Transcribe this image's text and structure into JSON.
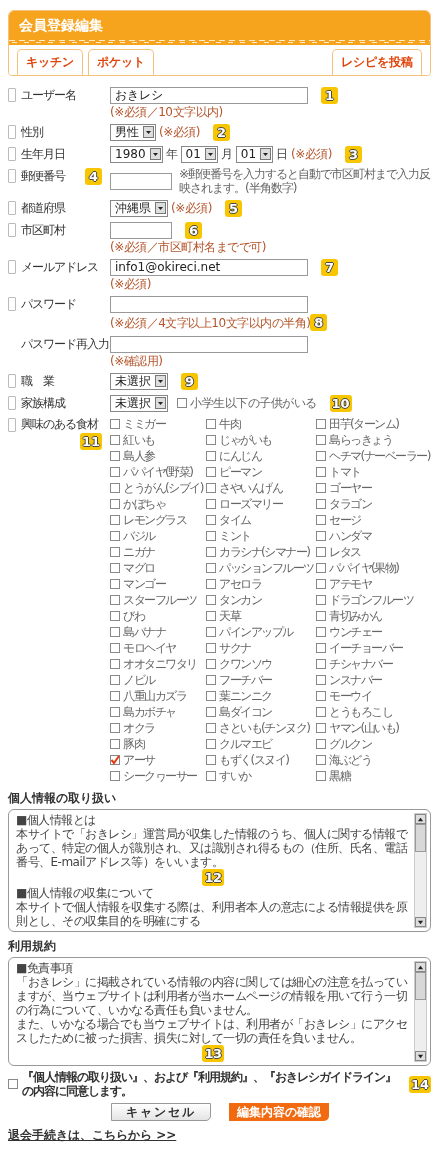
{
  "header": {
    "title": "会員登録編集",
    "tabs": [
      {
        "label": "キッチン",
        "kind": "section"
      },
      {
        "label": "ポケット",
        "kind": "section"
      },
      {
        "label": "レシピを投稿",
        "kind": "action"
      }
    ]
  },
  "form": {
    "rows": [
      {
        "kind": "text",
        "marker": true,
        "label": "ユーザー名",
        "value": "おきレシ",
        "hint": "(※必須／10文字以内)",
        "field_badge": "1"
      },
      {
        "kind": "select",
        "marker": true,
        "label": "性別",
        "value": "男性",
        "note": "(※必須)",
        "field_badge": "2"
      },
      {
        "kind": "date",
        "marker": true,
        "label": "生年月日",
        "parts": [
          {
            "value": "1980",
            "unit": "年"
          },
          {
            "value": "01",
            "unit": "月"
          },
          {
            "value": "01",
            "unit": "日"
          }
        ],
        "note": "(※必須)",
        "field_badge": "3"
      },
      {
        "kind": "short_text",
        "marker": true,
        "label": "郵便番号",
        "info": "※郵便番号を入力すると自動で市区町村まで入力反映されます。(半角数字)",
        "label_badge": "4"
      },
      {
        "kind": "select",
        "marker": true,
        "label": "都道府県",
        "value": "沖縄県",
        "note": "(※必須)",
        "field_badge": "5"
      },
      {
        "kind": "short_text",
        "marker": true,
        "label": "市区町村",
        "hint": "(※必須／市区町村名までで可)",
        "field_badge": "6"
      },
      {
        "kind": "text",
        "marker": true,
        "label": "メールアドレス",
        "value": "info1@okireci.net",
        "hint": "(※必須)",
        "field_badge": "7"
      },
      {
        "kind": "text",
        "marker": true,
        "label": "パスワード",
        "hint": "(※必須／4文字以上10文字以内の半角)",
        "hint_badge": "8"
      },
      {
        "kind": "text",
        "marker": false,
        "label": "パスワード再入力",
        "hint": "(※確認用)"
      },
      {
        "kind": "select",
        "marker": true,
        "label": "職　業",
        "value": "未選択",
        "field_badge": "9"
      },
      {
        "kind": "select",
        "marker": true,
        "label": "家族構成",
        "value": "未選択",
        "check": {
          "label": "小学生以下の子供がいる",
          "checked": false
        },
        "field_badge": "10"
      },
      {
        "kind": "checkbox_grid",
        "marker": true,
        "label": "興味のある食材",
        "label_badge": "11",
        "options": [
          {
            "label": "ミミガー",
            "checked": false
          },
          {
            "label": "牛肉",
            "checked": false
          },
          {
            "label": "田芋(ターンム)",
            "checked": false
          },
          {
            "label": "紅いも",
            "checked": false
          },
          {
            "label": "じゃがいも",
            "checked": false
          },
          {
            "label": "島らっきょう",
            "checked": false
          },
          {
            "label": "島人参",
            "checked": false
          },
          {
            "label": "にんじん",
            "checked": false
          },
          {
            "label": "ヘチマ(ナーベーラー)",
            "checked": false
          },
          {
            "label": "パパイヤ(野菜)",
            "checked": false
          },
          {
            "label": "ピーマン",
            "checked": false
          },
          {
            "label": "トマト",
            "checked": false
          },
          {
            "label": "とうがん(シブイ)",
            "checked": false
          },
          {
            "label": "さやいんげん",
            "checked": false
          },
          {
            "label": "ゴーヤー",
            "checked": false
          },
          {
            "label": "かぼちゃ",
            "checked": false
          },
          {
            "label": "ローズマリー",
            "checked": false
          },
          {
            "label": "タラゴン",
            "checked": false
          },
          {
            "label": "レモングラス",
            "checked": false
          },
          {
            "label": "タイム",
            "checked": false
          },
          {
            "label": "セージ",
            "checked": false
          },
          {
            "label": "バジル",
            "checked": false
          },
          {
            "label": "ミント",
            "checked": false
          },
          {
            "label": "ハンダマ",
            "checked": false
          },
          {
            "label": "ニガナ",
            "checked": false
          },
          {
            "label": "カラシナ(シマナー)",
            "checked": false
          },
          {
            "label": "レタス",
            "checked": false
          },
          {
            "label": "マグロ",
            "checked": false
          },
          {
            "label": "パッションフルーツ",
            "checked": false
          },
          {
            "label": "パパイヤ(果物)",
            "checked": false
          },
          {
            "label": "マンゴー",
            "checked": false
          },
          {
            "label": "アセロラ",
            "checked": false
          },
          {
            "label": "アテモヤ",
            "checked": false
          },
          {
            "label": "スターフルーツ",
            "checked": false
          },
          {
            "label": "タンカン",
            "checked": false
          },
          {
            "label": "ドラゴンフルーツ",
            "checked": false
          },
          {
            "label": "びわ",
            "checked": false
          },
          {
            "label": "天草",
            "checked": false
          },
          {
            "label": "青切みかん",
            "checked": false
          },
          {
            "label": "島バナナ",
            "checked": false
          },
          {
            "label": "パインアップル",
            "checked": false
          },
          {
            "label": "ウンチェー",
            "checked": false
          },
          {
            "label": "モロヘイヤ",
            "checked": false
          },
          {
            "label": "サクナ",
            "checked": false
          },
          {
            "label": "イーチョーバー",
            "checked": false
          },
          {
            "label": "オオタニワタリ",
            "checked": false
          },
          {
            "label": "クワンソウ",
            "checked": false
          },
          {
            "label": "チシャナバー",
            "checked": false
          },
          {
            "label": "ノビル",
            "checked": false
          },
          {
            "label": "フーチバー",
            "checked": false
          },
          {
            "label": "ンスナバー",
            "checked": false
          },
          {
            "label": "八重山カズラ",
            "checked": false
          },
          {
            "label": "葉ニンニク",
            "checked": false
          },
          {
            "label": "モーウイ",
            "checked": false
          },
          {
            "label": "島カボチャ",
            "checked": false
          },
          {
            "label": "島ダイコン",
            "checked": false
          },
          {
            "label": "とうもろこし",
            "checked": false
          },
          {
            "label": "オクラ",
            "checked": false
          },
          {
            "label": "さといも(チンヌク)",
            "checked": false
          },
          {
            "label": "ヤマン(山いも)",
            "checked": false
          },
          {
            "label": "豚肉",
            "checked": false
          },
          {
            "label": "クルマエビ",
            "checked": false
          },
          {
            "label": "グルクン",
            "checked": false
          },
          {
            "label": "アーサ",
            "checked": true
          },
          {
            "label": "もずく(スヌイ)",
            "checked": false
          },
          {
            "label": "海ぶどう",
            "checked": false
          },
          {
            "label": "シークヮーサー",
            "checked": false
          },
          {
            "label": "すいか",
            "checked": false
          },
          {
            "label": "黒糖",
            "checked": false
          }
        ]
      }
    ]
  },
  "documents": [
    {
      "title": "個人情報の取り扱い",
      "content": [
        {
          "kind": "text",
          "text": "■個人情報とは"
        },
        {
          "kind": "text",
          "text": "本サイトで「おきレシ」運営局が収集した情報のうち、個人に関する情報であって、特定の個人が識別され、又は識別され得るもの（住所、氏名、電話番号、E-mailアドレス等）をいいます。"
        },
        {
          "kind": "badge",
          "text": "12"
        },
        {
          "kind": "text",
          "text": "■個人情報の収集について"
        },
        {
          "kind": "text",
          "text": "本サイトで個人情報を収集する際は、利用者本人の意志による情報提供を原則とし、その収集目的を明確にする"
        }
      ]
    },
    {
      "title": "利用規約",
      "content": [
        {
          "kind": "text",
          "text": "■免責事項"
        },
        {
          "kind": "text",
          "text": "「おきレシ」に掲載されている情報の内容に関しては細心の注意を払っていますが、当ウェブサイトは利用者が当ホームページの情報を用いて行う一切の行為について、いかなる責任も負いません。"
        },
        {
          "kind": "text",
          "text": "また、いかなる場合でも当ウェブサイトは、利用者が「おきレシ」にアクセスしたために被った損害、損失に対して一切の責任を負いません。"
        },
        {
          "kind": "badge",
          "text": "13"
        }
      ]
    }
  ],
  "agreement": {
    "label": "『個人情報の取り扱い』、および『利用規約』、『おきレシガイドライン』の内容に同意します。",
    "checked": false,
    "badge": "14"
  },
  "buttons": [
    {
      "label": "キャンセル",
      "kind": "secondary"
    },
    {
      "label": "編集内容の確認",
      "kind": "primary"
    }
  ],
  "footer_link": "退会手続きは、こちらから >>"
}
